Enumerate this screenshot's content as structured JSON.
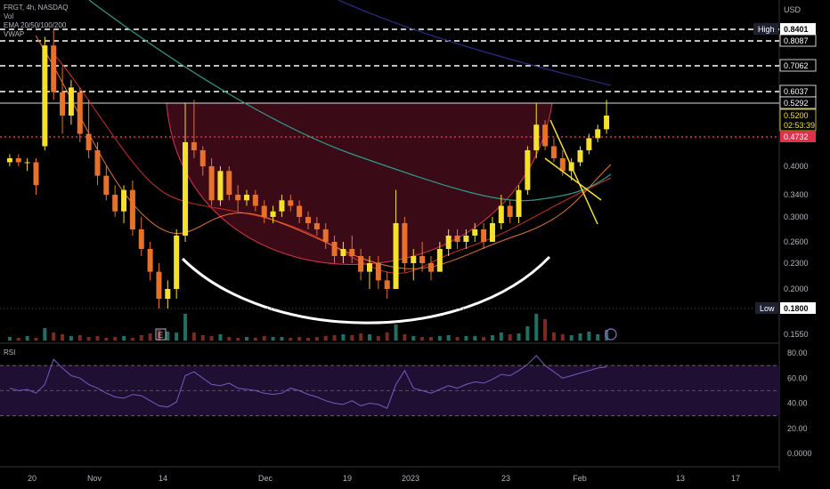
{
  "header": {
    "symbol_line": "FRGT, 4h, NASDAQ",
    "vol_label": "Vol",
    "ema_label": "EMA 20/50/100/200",
    "vwap_label": "VWAP"
  },
  "currency": "USD",
  "rsi_label": "RSI",
  "colors": {
    "up": "#f5e12b",
    "down": "#e8712a",
    "cup_fill": "#3a0a17",
    "cup_stroke": "#e0304a",
    "ema_teal": "#2f9a8a",
    "ema_navy": "#2a2a8a",
    "ema_red": "#d22a2a",
    "ema_orange": "#e8742a",
    "rsi": "#7e57c2",
    "current_price": "#ffffff",
    "red_level": "#e0304a"
  },
  "chart_data": [
    {
      "type": "candlestick",
      "title": "FRGT, 4h, NASDAQ",
      "y_axis_ticks": [
        "0.8087",
        "0.7062",
        "0.6037",
        "0.5292",
        "0.4000",
        "0.3400",
        "0.3000",
        "0.2600",
        "0.2300",
        "0.2000",
        "0.1550"
      ],
      "x_axis_ticks": [
        "20",
        "Nov",
        "14",
        "Dec",
        "19",
        "2023",
        "23",
        "Feb",
        "13",
        "17"
      ],
      "high_label": "High",
      "high_value": "0.8401",
      "low_label": "Low",
      "low_value": "0.1800",
      "current_price": "0.5200",
      "countdown": "02:53:39",
      "red_level": "0.4732",
      "horizontal_levels": [
        0.8401,
        0.8087,
        0.7062,
        0.6037
      ],
      "resistance_level": 0.5292,
      "event_marker": "E",
      "pattern": "cup",
      "series": [
        {
          "name": "EMA 20"
        },
        {
          "name": "EMA 50"
        },
        {
          "name": "EMA 100"
        },
        {
          "name": "EMA 200"
        },
        {
          "name": "VWAP"
        }
      ],
      "ohlc_approx": [
        [
          0.41,
          0.43,
          0.4,
          0.42
        ],
        [
          0.42,
          0.43,
          0.4,
          0.41
        ],
        [
          0.41,
          0.42,
          0.39,
          0.41
        ],
        [
          0.41,
          0.42,
          0.34,
          0.36
        ],
        [
          0.45,
          0.82,
          0.44,
          0.79
        ],
        [
          0.79,
          0.84,
          0.55,
          0.6
        ],
        [
          0.6,
          0.7,
          0.48,
          0.52
        ],
        [
          0.52,
          0.65,
          0.5,
          0.62
        ],
        [
          0.6,
          0.62,
          0.46,
          0.48
        ],
        [
          0.48,
          0.55,
          0.42,
          0.44
        ],
        [
          0.44,
          0.46,
          0.36,
          0.38
        ],
        [
          0.38,
          0.4,
          0.33,
          0.34
        ],
        [
          0.34,
          0.36,
          0.3,
          0.31
        ],
        [
          0.31,
          0.36,
          0.29,
          0.35
        ],
        [
          0.35,
          0.37,
          0.27,
          0.28
        ],
        [
          0.28,
          0.3,
          0.24,
          0.25
        ],
        [
          0.25,
          0.26,
          0.21,
          0.22
        ],
        [
          0.22,
          0.23,
          0.18,
          0.19
        ],
        [
          0.19,
          0.21,
          0.18,
          0.2
        ],
        [
          0.2,
          0.28,
          0.19,
          0.27
        ],
        [
          0.27,
          0.53,
          0.26,
          0.46
        ],
        [
          0.46,
          0.55,
          0.42,
          0.44
        ],
        [
          0.44,
          0.45,
          0.38,
          0.4
        ],
        [
          0.4,
          0.42,
          0.32,
          0.33
        ],
        [
          0.33,
          0.4,
          0.32,
          0.39
        ],
        [
          0.39,
          0.4,
          0.33,
          0.34
        ],
        [
          0.34,
          0.36,
          0.31,
          0.33
        ],
        [
          0.33,
          0.35,
          0.32,
          0.34
        ],
        [
          0.34,
          0.35,
          0.31,
          0.32
        ],
        [
          0.32,
          0.33,
          0.29,
          0.3
        ],
        [
          0.3,
          0.32,
          0.29,
          0.31
        ],
        [
          0.31,
          0.34,
          0.3,
          0.33
        ],
        [
          0.33,
          0.34,
          0.31,
          0.32
        ],
        [
          0.32,
          0.33,
          0.29,
          0.3
        ],
        [
          0.3,
          0.31,
          0.28,
          0.29
        ],
        [
          0.29,
          0.3,
          0.27,
          0.28
        ],
        [
          0.28,
          0.29,
          0.25,
          0.26
        ],
        [
          0.26,
          0.27,
          0.23,
          0.24
        ],
        [
          0.24,
          0.26,
          0.23,
          0.25
        ],
        [
          0.25,
          0.27,
          0.23,
          0.24
        ],
        [
          0.24,
          0.25,
          0.21,
          0.22
        ],
        [
          0.22,
          0.24,
          0.2,
          0.23
        ],
        [
          0.23,
          0.24,
          0.2,
          0.21
        ],
        [
          0.21,
          0.22,
          0.19,
          0.2
        ],
        [
          0.2,
          0.35,
          0.2,
          0.29
        ],
        [
          0.29,
          0.3,
          0.22,
          0.23
        ],
        [
          0.23,
          0.25,
          0.21,
          0.24
        ],
        [
          0.24,
          0.26,
          0.22,
          0.23
        ],
        [
          0.23,
          0.24,
          0.21,
          0.22
        ],
        [
          0.22,
          0.26,
          0.22,
          0.25
        ],
        [
          0.25,
          0.28,
          0.24,
          0.27
        ],
        [
          0.27,
          0.28,
          0.25,
          0.26
        ],
        [
          0.26,
          0.28,
          0.25,
          0.27
        ],
        [
          0.27,
          0.29,
          0.26,
          0.28
        ],
        [
          0.28,
          0.29,
          0.25,
          0.26
        ],
        [
          0.26,
          0.3,
          0.26,
          0.29
        ],
        [
          0.29,
          0.34,
          0.28,
          0.32
        ],
        [
          0.32,
          0.33,
          0.29,
          0.3
        ],
        [
          0.3,
          0.36,
          0.29,
          0.35
        ],
        [
          0.35,
          0.45,
          0.34,
          0.44
        ],
        [
          0.44,
          0.53,
          0.42,
          0.5
        ],
        [
          0.5,
          0.51,
          0.44,
          0.45
        ],
        [
          0.45,
          0.47,
          0.41,
          0.42
        ],
        [
          0.42,
          0.44,
          0.38,
          0.39
        ],
        [
          0.39,
          0.42,
          0.37,
          0.41
        ],
        [
          0.41,
          0.45,
          0.4,
          0.44
        ],
        [
          0.44,
          0.48,
          0.43,
          0.47
        ],
        [
          0.47,
          0.5,
          0.46,
          0.49
        ],
        [
          0.49,
          0.55,
          0.48,
          0.52
        ]
      ]
    },
    {
      "type": "line",
      "title": "RSI",
      "y_axis_ticks": [
        "80.00",
        "60.00",
        "40.00",
        "20.00",
        "0.0000"
      ],
      "bands": [
        70,
        30
      ],
      "midline": 50,
      "ylim": [
        0,
        85
      ],
      "series": [
        {
          "values": [
            52,
            50,
            51,
            48,
            55,
            75,
            68,
            62,
            60,
            55,
            52,
            48,
            45,
            44,
            47,
            46,
            42,
            38,
            37,
            41,
            62,
            65,
            60,
            55,
            54,
            56,
            52,
            51,
            50,
            48,
            47,
            48,
            52,
            50,
            47,
            45,
            42,
            40,
            39,
            42,
            38,
            40,
            39,
            36,
            55,
            66,
            52,
            50,
            48,
            51,
            54,
            52,
            55,
            57,
            56,
            59,
            63,
            62,
            66,
            71,
            78,
            70,
            65,
            60,
            62,
            64,
            66,
            68,
            69
          ]
        }
      ]
    }
  ]
}
